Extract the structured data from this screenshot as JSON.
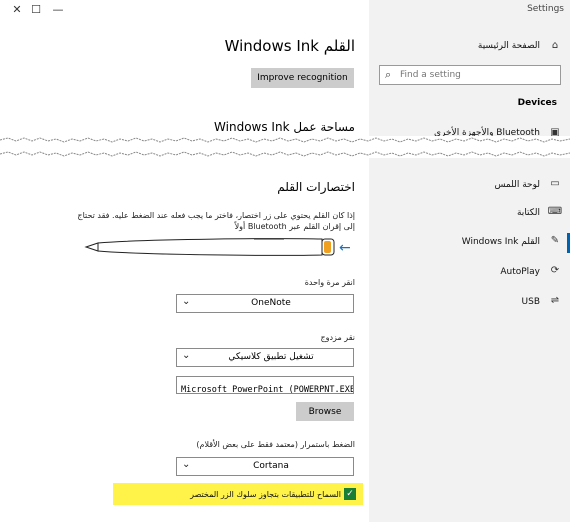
{
  "window": {
    "title": "Settings",
    "close_glyph": "✕",
    "maximize_glyph": "☐",
    "minimize_glyph": "—"
  },
  "sidebar": {
    "home_label": "الصفحة الرئيسية",
    "search_placeholder": "Find a setting",
    "section_title": "Devices",
    "items": [
      {
        "label": "Bluetooth والأجهزة الأخرى",
        "icon": "bluetooth-devices-icon"
      },
      {
        "label": "لوحة اللمس",
        "icon": "touchpad-icon"
      },
      {
        "label": "الكتابة",
        "icon": "keyboard-icon"
      },
      {
        "label": "القلم Windows Ink",
        "icon": "pen-icon"
      },
      {
        "label": "AutoPlay",
        "icon": "autoplay-icon"
      },
      {
        "label": "USB",
        "icon": "usb-icon"
      }
    ],
    "accent_color": "#0063b1"
  },
  "main": {
    "page_title": "القلم Windows Ink",
    "improve_button": "Improve recognition",
    "workspace_heading": "مساحة عمل Windows Ink",
    "shortcuts_heading": "اختصارات القلم",
    "shortcuts_desc": "إذا كان القلم يحتوي على زر اختصار، فاختر ما يجب فعله عند الضغط عليه. فقد تحتاج إلى إقران القلم عبر Bluetooth أولاً",
    "single_click_label": "انقر مرة واحدة",
    "single_click_value": "OneNote",
    "double_click_label": "نقر مزدوج",
    "double_click_value": "تشغيل تطبيق كلاسيكي",
    "app_path_value": "Microsoft PowerPoint (POWERPNT.EXE)",
    "browse_button": "Browse",
    "press_hold_label": "الضغط باستمرار (معتمد فقط على بعض الأقلام)",
    "press_hold_value": "Cortana",
    "override_checkbox_label": "السماح للتطبيقات بتجاوز سلوك الزر المختصر",
    "override_checked": true,
    "highlight_color": "#fff34a",
    "checkbox_color": "#1b7e35"
  }
}
